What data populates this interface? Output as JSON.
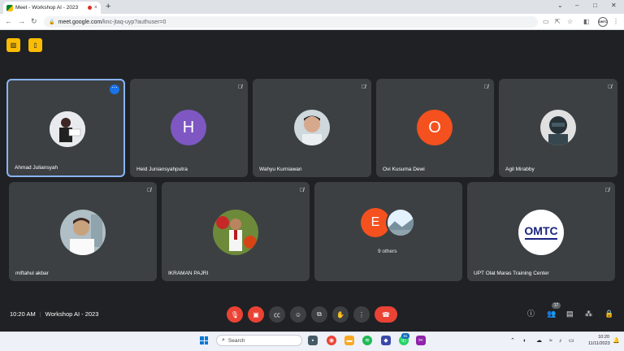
{
  "browser": {
    "tab_title": "Meet - Workshop AI - 2023",
    "tab_close": "×",
    "new_tab": "+",
    "window_controls": {
      "dropdown": "⌄",
      "minimize": "–",
      "maximize": "□",
      "close": "✕"
    },
    "nav": {
      "back": "←",
      "forward": "→",
      "reload": "↻"
    },
    "url_host": "meet.google.com",
    "url_path": "/knc-jtaq-uyp?authuser=0",
    "profile_label": "OMTC"
  },
  "meet": {
    "participants": [
      {
        "name": "Ahmad Juliansyah",
        "avatar": "photo",
        "active": true
      },
      {
        "name": "Heid Juniansyahputra",
        "avatar": "letter",
        "letter": "H",
        "color": "#7e57c2",
        "muted": true
      },
      {
        "name": "Wahyu Kurniawan",
        "avatar": "photo",
        "muted": true
      },
      {
        "name": "Ovi Kusuma Dewi",
        "avatar": "letter",
        "letter": "O",
        "color": "#f4511e",
        "muted": true
      },
      {
        "name": "Agil Mirabby",
        "avatar": "photo",
        "muted": true
      },
      {
        "name": "miftahul akbar",
        "avatar": "photo",
        "muted": true
      },
      {
        "name": "IKRAMAN PAJRI",
        "avatar": "photo",
        "muted": true
      },
      {
        "name": "UPT Olat Maras Training Center",
        "avatar": "logo",
        "logo_text": "OMTC",
        "muted": true
      }
    ],
    "others": {
      "letter": "E",
      "color": "#f4511e",
      "label": "9 others"
    },
    "time": "10:20 AM",
    "meeting_title": "Workshop AI - 2023",
    "people_count": "17",
    "accent_color": "#8ab4f8",
    "danger_color": "#ea4335"
  },
  "taskbar": {
    "search_placeholder": "Search",
    "whatsapp_badge": "81",
    "time": "10:20",
    "date": "11/11/2023"
  }
}
